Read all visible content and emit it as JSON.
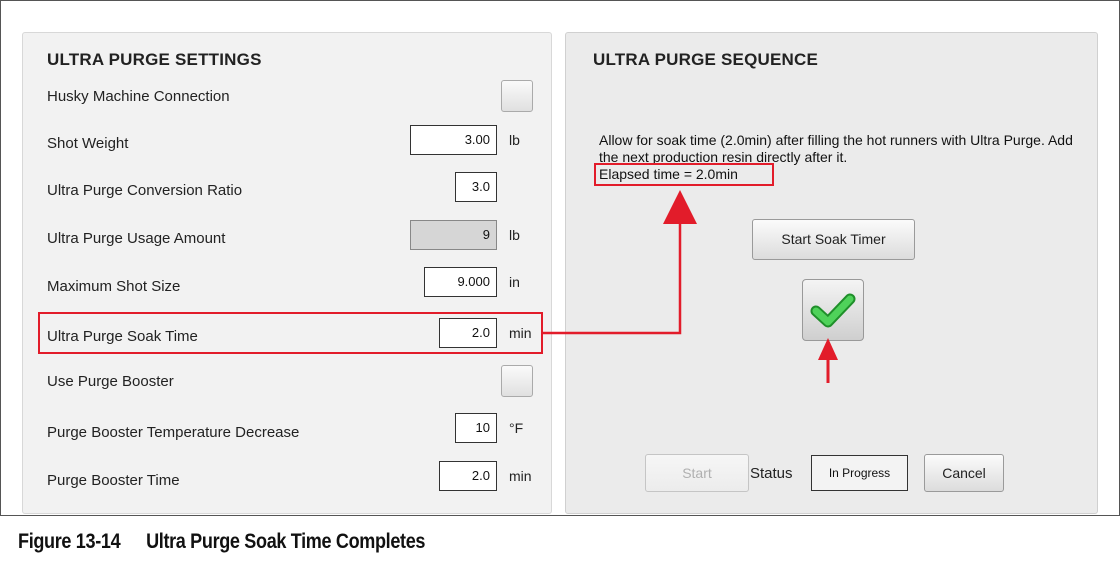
{
  "settings": {
    "title": "ULTRA PURGE SETTINGS",
    "rows": [
      {
        "label": "Husky Machine Connection",
        "type": "checkbox",
        "checked": false
      },
      {
        "label": "Shot Weight",
        "value": "3.00",
        "unit": "lb"
      },
      {
        "label": "Ultra Purge Conversion Ratio",
        "value": "3.0",
        "unit": ""
      },
      {
        "label": "Ultra Purge Usage Amount",
        "value": "9",
        "unit": "lb",
        "readonly": true
      },
      {
        "label": "Maximum Shot Size",
        "value": "9.000",
        "unit": "in"
      },
      {
        "label": "Ultra Purge Soak Time",
        "value": "2.0",
        "unit": "min",
        "highlighted": true
      },
      {
        "label": "Use Purge Booster",
        "type": "checkbox",
        "checked": false
      },
      {
        "label": "Purge Booster Temperature Decrease",
        "value": "10",
        "unit": "°F"
      },
      {
        "label": "Purge Booster Time",
        "value": "2.0",
        "unit": "min"
      }
    ]
  },
  "sequence": {
    "title": "ULTRA PURGE SEQUENCE",
    "description": "Allow for soak time (2.0min) after filling the hot runners with Ultra Purge. Add the next production resin directly after it.",
    "elapsed": "Elapsed time = 2.0min",
    "start_soak_button": "Start Soak Timer",
    "complete_icon": "check-icon",
    "start_button": "Start",
    "status_label": "Status",
    "status_value": "In Progress",
    "cancel_button": "Cancel"
  },
  "caption": {
    "figure": "Figure 13-14",
    "text": "Ultra Purge Soak Time Completes"
  },
  "colors": {
    "highlight": "#e21c2a",
    "check": "#3fbf4a"
  }
}
